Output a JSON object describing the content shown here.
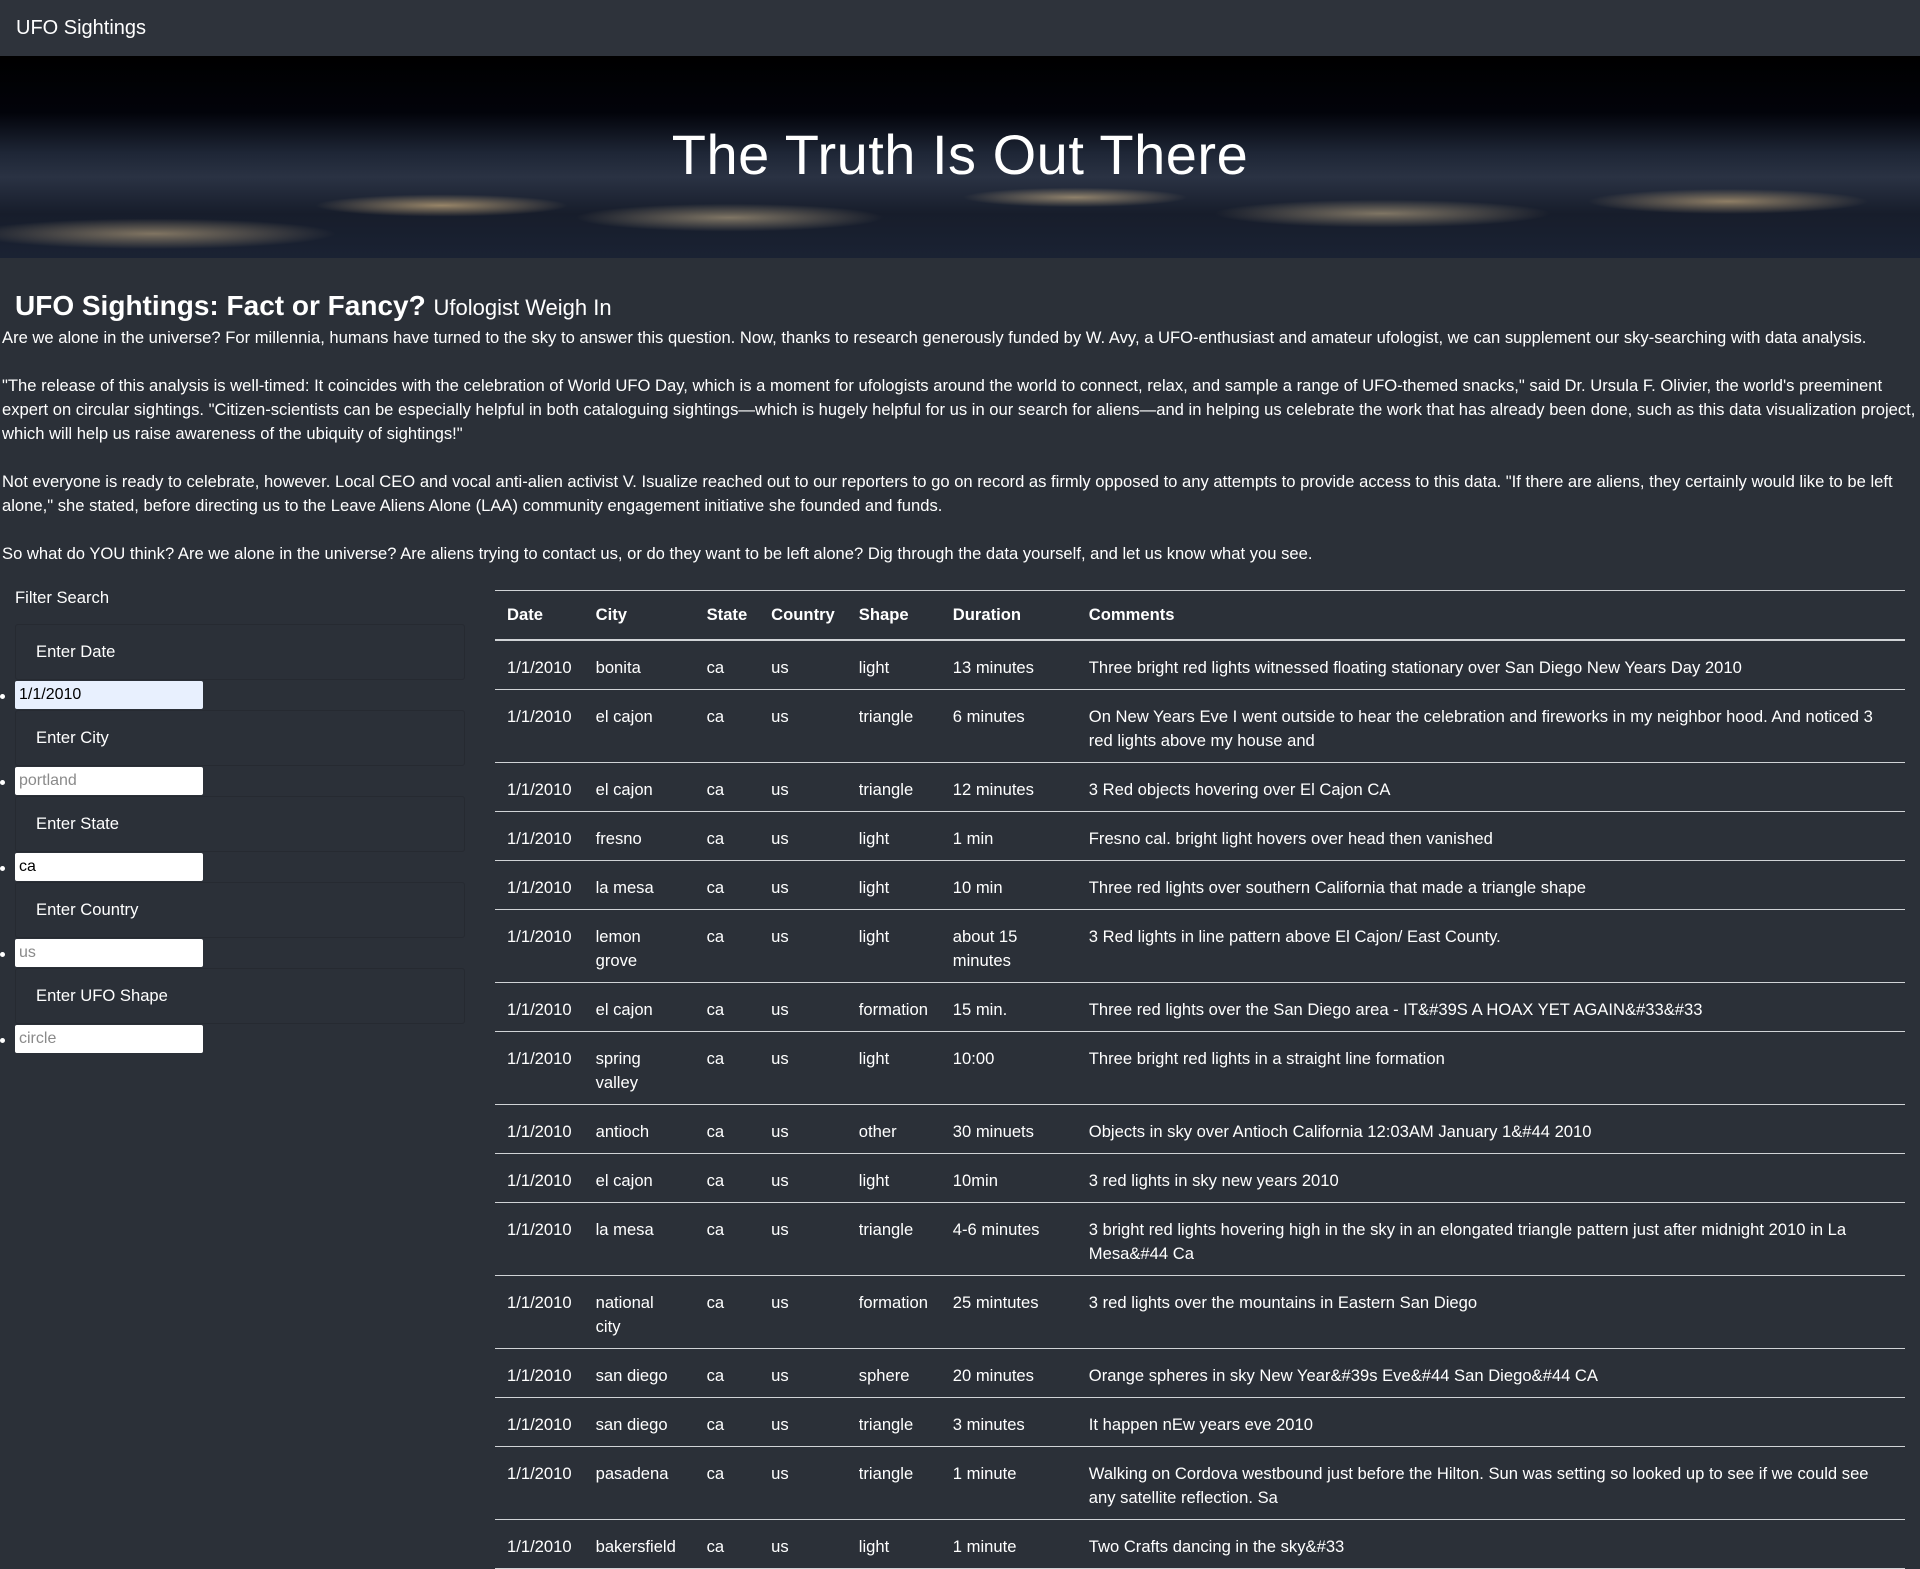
{
  "navbar": {
    "brand": "UFO Sightings"
  },
  "hero": {
    "title": "The Truth Is Out There"
  },
  "article": {
    "heading": "UFO Sightings: Fact or Fancy?",
    "subheading": "Ufologist Weigh In",
    "paragraphs": [
      "Are we alone in the universe? For millennia, humans have turned to the sky to answer this question. Now, thanks to research generously funded by W. Avy, a UFO-enthusiast and amateur ufologist, we can supplement our sky-searching with data analysis.",
      "\"The release of this analysis is well-timed: It coincides with the celebration of World UFO Day, which is a moment for ufologists around the world to connect, relax, and sample a range of UFO-themed snacks,\" said Dr. Ursula F. Olivier, the world's preeminent expert on circular sightings. \"Citizen-scientists can be especially helpful in both cataloguing sightings—which is hugely helpful for us in our search for aliens—and in helping us celebrate the work that has already been done, such as this data visualization project, which will help us raise awareness of the ubiquity of sightings!\"",
      "Not everyone is ready to celebrate, however. Local CEO and vocal anti-alien activist V. Isualize reached out to our reporters to go on record as firmly opposed to any attempts to provide access to this data. \"If there are aliens, they certainly would like to be left alone,\" she stated, before directing us to the Leave Aliens Alone (LAA) community engagement initiative she founded and funds.",
      "So what do YOU think? Are we alone in the universe? Are aliens trying to contact us, or do they want to be left alone? Dig through the data yourself, and let us know what you see."
    ]
  },
  "filters": {
    "title": "Filter Search",
    "date": {
      "label": "Enter Date",
      "value": "1/1/2010",
      "placeholder": ""
    },
    "city": {
      "label": "Enter City",
      "value": "",
      "placeholder": "portland"
    },
    "state": {
      "label": "Enter State",
      "value": "ca",
      "placeholder": ""
    },
    "country": {
      "label": "Enter Country",
      "value": "",
      "placeholder": "us"
    },
    "shape": {
      "label": "Enter UFO Shape",
      "value": "",
      "placeholder": "circle"
    }
  },
  "table": {
    "headers": [
      "Date",
      "City",
      "State",
      "Country",
      "Shape",
      "Duration",
      "Comments"
    ],
    "rows": [
      [
        "1/1/2010",
        "bonita",
        "ca",
        "us",
        "light",
        "13 minutes",
        "Three bright red lights witnessed floating stationary over San Diego New Years Day 2010"
      ],
      [
        "1/1/2010",
        "el cajon",
        "ca",
        "us",
        "triangle",
        "6 minutes",
        "On New Years Eve I went outside to hear the celebration and fireworks in my neighbor hood. And noticed 3 red lights above my house and"
      ],
      [
        "1/1/2010",
        "el cajon",
        "ca",
        "us",
        "triangle",
        "12 minutes",
        "3 Red objects hovering over El Cajon CA"
      ],
      [
        "1/1/2010",
        "fresno",
        "ca",
        "us",
        "light",
        "1 min",
        "Fresno cal. bright light hovers over head then vanished"
      ],
      [
        "1/1/2010",
        "la mesa",
        "ca",
        "us",
        "light",
        "10 min",
        "Three red lights over southern California that made a triangle shape"
      ],
      [
        "1/1/2010",
        "lemon grove",
        "ca",
        "us",
        "light",
        "about 15 minutes",
        "3 Red lights in line pattern above El Cajon/ East County."
      ],
      [
        "1/1/2010",
        "el cajon",
        "ca",
        "us",
        "formation",
        "15 min.",
        "Three red lights over the San Diego area - IT&#39S A HOAX YET AGAIN&#33&#33"
      ],
      [
        "1/1/2010",
        "spring valley",
        "ca",
        "us",
        "light",
        "10:00",
        "Three bright red lights in a straight line formation"
      ],
      [
        "1/1/2010",
        "antioch",
        "ca",
        "us",
        "other",
        "30 minuets",
        "Objects in sky over Antioch California 12:03AM January 1&#44 2010"
      ],
      [
        "1/1/2010",
        "el cajon",
        "ca",
        "us",
        "light",
        "10min",
        "3 red lights in sky new years 2010"
      ],
      [
        "1/1/2010",
        "la mesa",
        "ca",
        "us",
        "triangle",
        "4-6 minutes",
        "3 bright red lights hovering high in the sky in an elongated triangle pattern just after midnight 2010 in La Mesa&#44 Ca"
      ],
      [
        "1/1/2010",
        "national city",
        "ca",
        "us",
        "formation",
        "25 mintutes",
        "3 red lights over the mountains in Eastern San Diego"
      ],
      [
        "1/1/2010",
        "san diego",
        "ca",
        "us",
        "sphere",
        "20 minutes",
        "Orange spheres in sky New Year&#39s Eve&#44 San Diego&#44 CA"
      ],
      [
        "1/1/2010",
        "san diego",
        "ca",
        "us",
        "triangle",
        "3 minutes",
        "It happen nEw years eve 2010"
      ],
      [
        "1/1/2010",
        "pasadena",
        "ca",
        "us",
        "triangle",
        "1 minute",
        "Walking on Cordova westbound just before the Hilton. Sun was setting so looked up to see if we could see any satellite reflection. Sa"
      ],
      [
        "1/1/2010",
        "bakersfield",
        "ca",
        "us",
        "light",
        "1 minute",
        "Two Crafts dancing in the sky&#33"
      ]
    ]
  }
}
